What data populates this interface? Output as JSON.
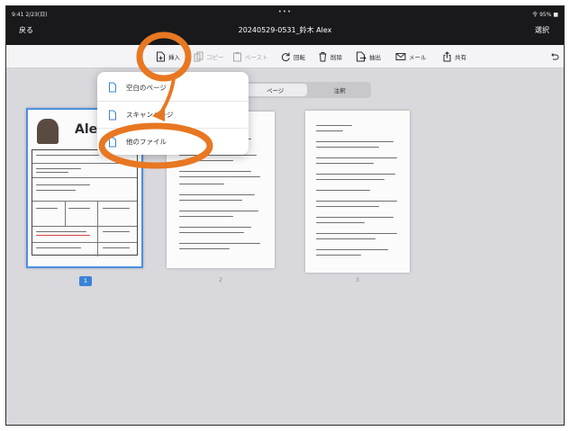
{
  "status_bar": {
    "left": "9:41 2/23(日)",
    "center": "•••",
    "right": "令 95% ■"
  },
  "nav": {
    "back_label": "戻る",
    "title": "20240529-0531_鈴木 Alex",
    "select_label": "選択"
  },
  "toolbar": {
    "items": [
      {
        "label": "挿入",
        "icon": "insert-doc-icon"
      },
      {
        "label": "コピー",
        "icon": "copy-icon"
      },
      {
        "label": "ペースト",
        "icon": "paste-icon"
      },
      {
        "label": "回転",
        "icon": "rotate-icon"
      },
      {
        "label": "削除",
        "icon": "trash-icon"
      },
      {
        "label": "抽出",
        "icon": "extract-icon"
      },
      {
        "label": "メール",
        "icon": "mail-icon"
      },
      {
        "label": "共有",
        "icon": "share-icon"
      }
    ],
    "undo_icon": "undo-icon"
  },
  "insert_menu": {
    "items": [
      {
        "label": "空白のページ",
        "icon": "doc-icon"
      },
      {
        "label": "スキャンページ",
        "icon": "doc-icon"
      },
      {
        "label": "他のファイル",
        "icon": "doc-icon"
      }
    ]
  },
  "segment": {
    "options": [
      "ページ",
      "注釈"
    ],
    "selected": "ページ"
  },
  "pages": [
    {
      "number": "1",
      "selected": true,
      "name_fragment": "Ale"
    },
    {
      "number": "2",
      "selected": false
    },
    {
      "number": "3",
      "selected": false
    }
  ],
  "annotation_color": "#E87722",
  "accent_color": "#3B82D8"
}
